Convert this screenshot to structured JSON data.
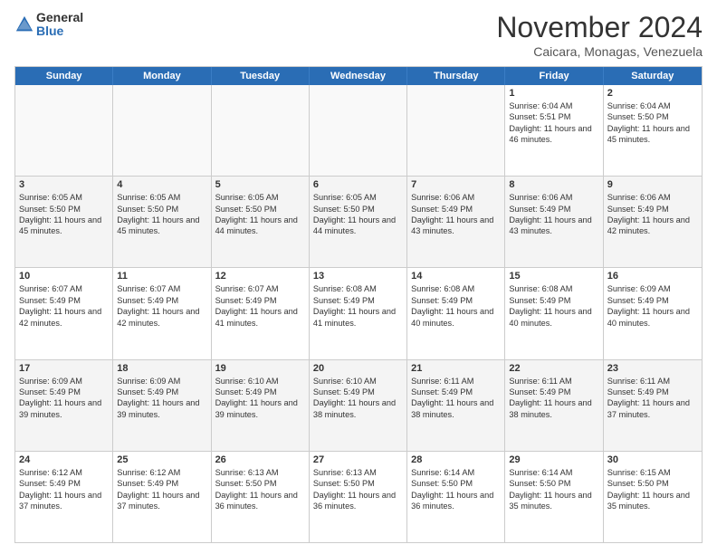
{
  "logo": {
    "general": "General",
    "blue": "Blue"
  },
  "title": "November 2024",
  "subtitle": "Caicara, Monagas, Venezuela",
  "days_of_week": [
    "Sunday",
    "Monday",
    "Tuesday",
    "Wednesday",
    "Thursday",
    "Friday",
    "Saturday"
  ],
  "weeks": [
    [
      {
        "day": "",
        "info": ""
      },
      {
        "day": "",
        "info": ""
      },
      {
        "day": "",
        "info": ""
      },
      {
        "day": "",
        "info": ""
      },
      {
        "day": "",
        "info": ""
      },
      {
        "day": "1",
        "info": "Sunrise: 6:04 AM\nSunset: 5:51 PM\nDaylight: 11 hours and 46 minutes."
      },
      {
        "day": "2",
        "info": "Sunrise: 6:04 AM\nSunset: 5:50 PM\nDaylight: 11 hours and 45 minutes."
      }
    ],
    [
      {
        "day": "3",
        "info": "Sunrise: 6:05 AM\nSunset: 5:50 PM\nDaylight: 11 hours and 45 minutes."
      },
      {
        "day": "4",
        "info": "Sunrise: 6:05 AM\nSunset: 5:50 PM\nDaylight: 11 hours and 45 minutes."
      },
      {
        "day": "5",
        "info": "Sunrise: 6:05 AM\nSunset: 5:50 PM\nDaylight: 11 hours and 44 minutes."
      },
      {
        "day": "6",
        "info": "Sunrise: 6:05 AM\nSunset: 5:50 PM\nDaylight: 11 hours and 44 minutes."
      },
      {
        "day": "7",
        "info": "Sunrise: 6:06 AM\nSunset: 5:49 PM\nDaylight: 11 hours and 43 minutes."
      },
      {
        "day": "8",
        "info": "Sunrise: 6:06 AM\nSunset: 5:49 PM\nDaylight: 11 hours and 43 minutes."
      },
      {
        "day": "9",
        "info": "Sunrise: 6:06 AM\nSunset: 5:49 PM\nDaylight: 11 hours and 42 minutes."
      }
    ],
    [
      {
        "day": "10",
        "info": "Sunrise: 6:07 AM\nSunset: 5:49 PM\nDaylight: 11 hours and 42 minutes."
      },
      {
        "day": "11",
        "info": "Sunrise: 6:07 AM\nSunset: 5:49 PM\nDaylight: 11 hours and 42 minutes."
      },
      {
        "day": "12",
        "info": "Sunrise: 6:07 AM\nSunset: 5:49 PM\nDaylight: 11 hours and 41 minutes."
      },
      {
        "day": "13",
        "info": "Sunrise: 6:08 AM\nSunset: 5:49 PM\nDaylight: 11 hours and 41 minutes."
      },
      {
        "day": "14",
        "info": "Sunrise: 6:08 AM\nSunset: 5:49 PM\nDaylight: 11 hours and 40 minutes."
      },
      {
        "day": "15",
        "info": "Sunrise: 6:08 AM\nSunset: 5:49 PM\nDaylight: 11 hours and 40 minutes."
      },
      {
        "day": "16",
        "info": "Sunrise: 6:09 AM\nSunset: 5:49 PM\nDaylight: 11 hours and 40 minutes."
      }
    ],
    [
      {
        "day": "17",
        "info": "Sunrise: 6:09 AM\nSunset: 5:49 PM\nDaylight: 11 hours and 39 minutes."
      },
      {
        "day": "18",
        "info": "Sunrise: 6:09 AM\nSunset: 5:49 PM\nDaylight: 11 hours and 39 minutes."
      },
      {
        "day": "19",
        "info": "Sunrise: 6:10 AM\nSunset: 5:49 PM\nDaylight: 11 hours and 39 minutes."
      },
      {
        "day": "20",
        "info": "Sunrise: 6:10 AM\nSunset: 5:49 PM\nDaylight: 11 hours and 38 minutes."
      },
      {
        "day": "21",
        "info": "Sunrise: 6:11 AM\nSunset: 5:49 PM\nDaylight: 11 hours and 38 minutes."
      },
      {
        "day": "22",
        "info": "Sunrise: 6:11 AM\nSunset: 5:49 PM\nDaylight: 11 hours and 38 minutes."
      },
      {
        "day": "23",
        "info": "Sunrise: 6:11 AM\nSunset: 5:49 PM\nDaylight: 11 hours and 37 minutes."
      }
    ],
    [
      {
        "day": "24",
        "info": "Sunrise: 6:12 AM\nSunset: 5:49 PM\nDaylight: 11 hours and 37 minutes."
      },
      {
        "day": "25",
        "info": "Sunrise: 6:12 AM\nSunset: 5:49 PM\nDaylight: 11 hours and 37 minutes."
      },
      {
        "day": "26",
        "info": "Sunrise: 6:13 AM\nSunset: 5:50 PM\nDaylight: 11 hours and 36 minutes."
      },
      {
        "day": "27",
        "info": "Sunrise: 6:13 AM\nSunset: 5:50 PM\nDaylight: 11 hours and 36 minutes."
      },
      {
        "day": "28",
        "info": "Sunrise: 6:14 AM\nSunset: 5:50 PM\nDaylight: 11 hours and 36 minutes."
      },
      {
        "day": "29",
        "info": "Sunrise: 6:14 AM\nSunset: 5:50 PM\nDaylight: 11 hours and 35 minutes."
      },
      {
        "day": "30",
        "info": "Sunrise: 6:15 AM\nSunset: 5:50 PM\nDaylight: 11 hours and 35 minutes."
      }
    ]
  ]
}
